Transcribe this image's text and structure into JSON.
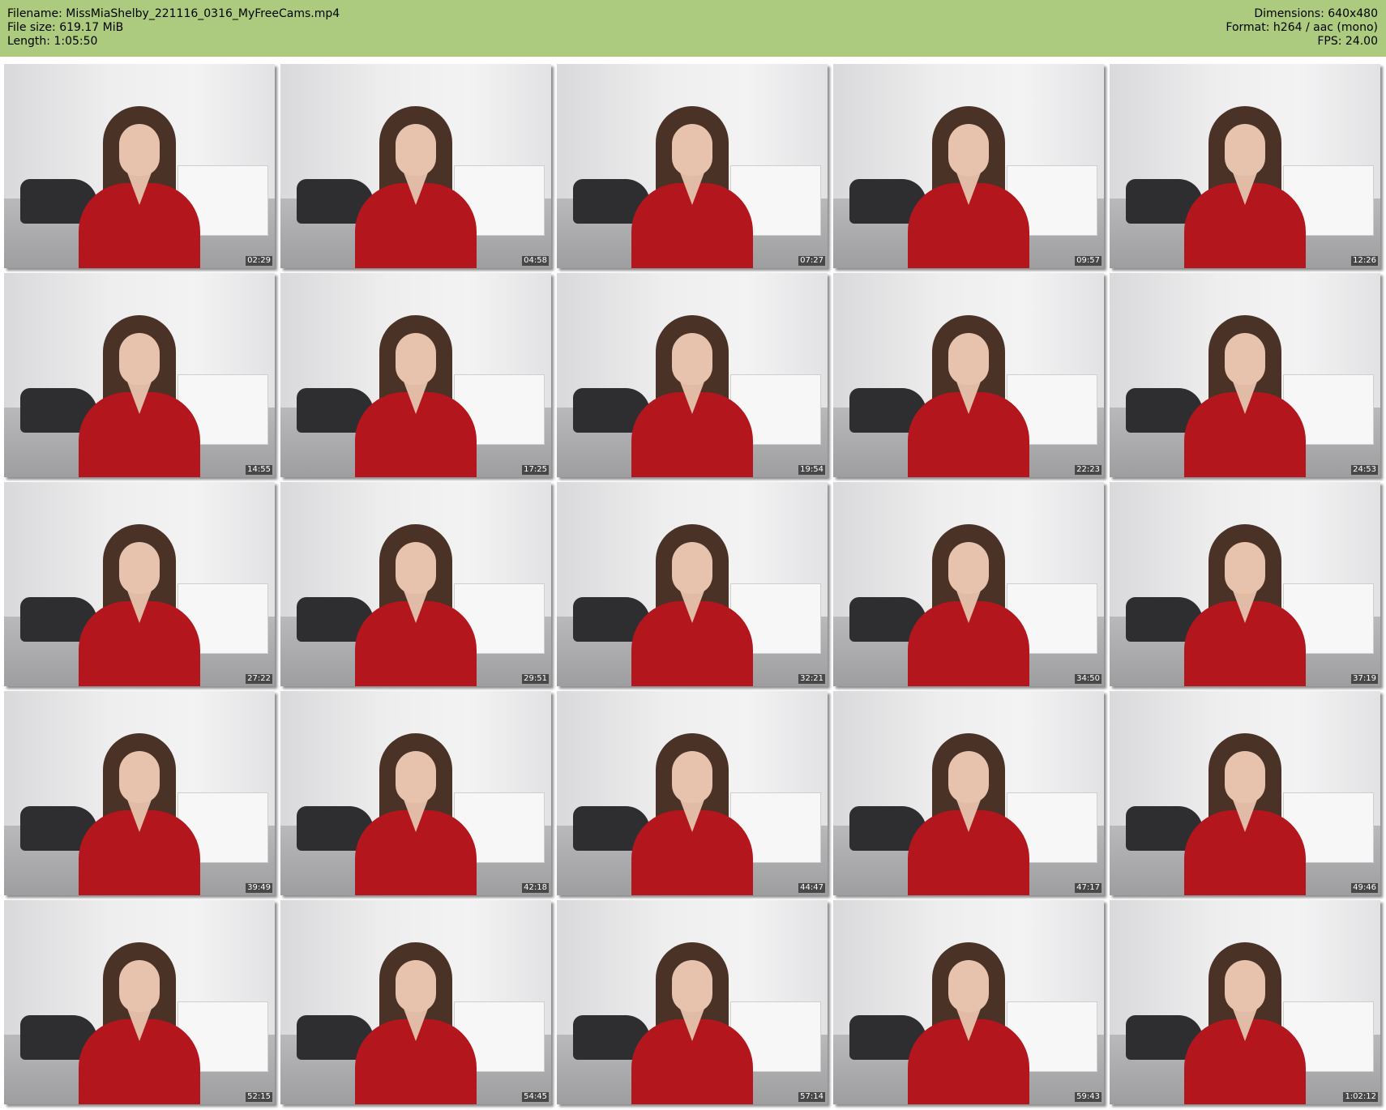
{
  "header": {
    "filename_label": "Filename: MissMiaShelby_221116_0316_MyFreeCams.mp4",
    "filesize_label": "File size: 619.17 MiB",
    "length_label": "Length: 1:05:50",
    "dimensions_label": "Dimensions: 640x480",
    "format_label": "Format: h264 / aac (mono)",
    "fps_label": "FPS: 24.00"
  },
  "colors": {
    "header_bg": "#adcb7e",
    "outfit": "#b3161c"
  },
  "thumbnails": [
    {
      "timestamp": "02:29"
    },
    {
      "timestamp": "04:58"
    },
    {
      "timestamp": "07:27"
    },
    {
      "timestamp": "09:57"
    },
    {
      "timestamp": "12:26"
    },
    {
      "timestamp": "14:55"
    },
    {
      "timestamp": "17:25"
    },
    {
      "timestamp": "19:54"
    },
    {
      "timestamp": "22:23"
    },
    {
      "timestamp": "24:53"
    },
    {
      "timestamp": "27:22"
    },
    {
      "timestamp": "29:51"
    },
    {
      "timestamp": "32:21"
    },
    {
      "timestamp": "34:50"
    },
    {
      "timestamp": "37:19"
    },
    {
      "timestamp": "39:49"
    },
    {
      "timestamp": "42:18"
    },
    {
      "timestamp": "44:47"
    },
    {
      "timestamp": "47:17"
    },
    {
      "timestamp": "49:46"
    },
    {
      "timestamp": "52:15"
    },
    {
      "timestamp": "54:45"
    },
    {
      "timestamp": "57:14"
    },
    {
      "timestamp": "59:43"
    },
    {
      "timestamp": "1:02:12"
    }
  ]
}
